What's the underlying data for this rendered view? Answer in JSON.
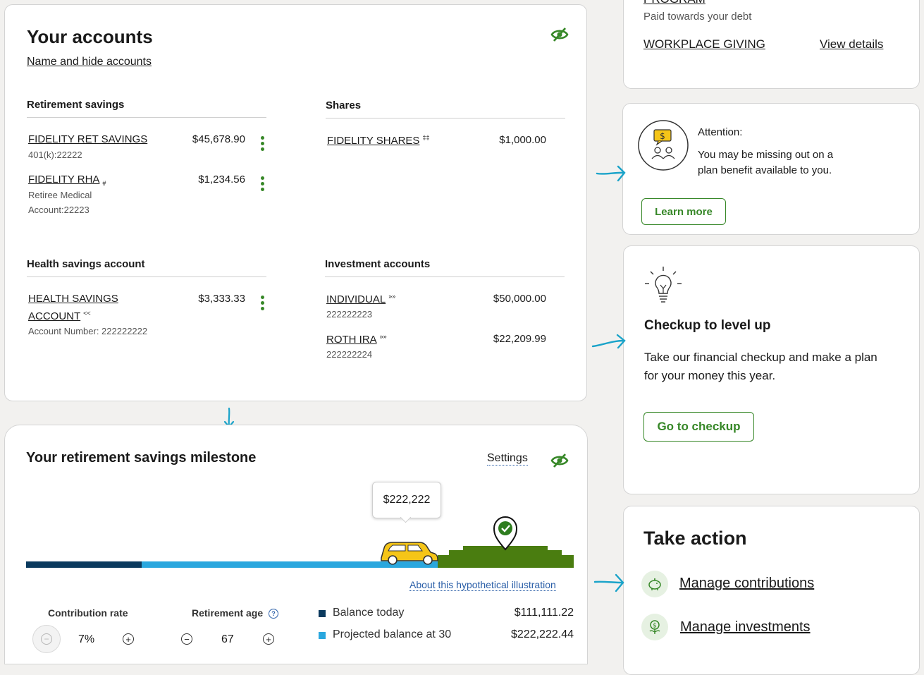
{
  "accounts": {
    "title": "Your accounts",
    "name_hide_link": "Name and hide accounts",
    "retirement": {
      "heading": "Retirement savings",
      "items": [
        {
          "name": "FIDELITY RET SAVINGS",
          "sub": "401(k):22222",
          "amount": "$45,678.90"
        },
        {
          "name": "FIDELITY RHA",
          "mark": "#",
          "sub1": "Retiree Medical",
          "sub2": "Account:22223",
          "amount": "$1,234.56"
        }
      ]
    },
    "shares": {
      "heading": "Shares",
      "items": [
        {
          "name": "FIDELITY SHARES",
          "mark": "‡‡",
          "amount": "$1,000.00"
        }
      ]
    },
    "hsa": {
      "heading": "Health savings account",
      "items": [
        {
          "name1": "HEALTH SAVINGS",
          "name2": "ACCOUNT",
          "mark": "<<",
          "sub": "Account Number: 222222222",
          "amount": "$3,333.33"
        }
      ]
    },
    "investment": {
      "heading": "Investment accounts",
      "items": [
        {
          "name": "INDIVIDUAL",
          "mark": "»»",
          "sub": "222222223",
          "amount": "$50,000.00"
        },
        {
          "name": "ROTH IRA",
          "mark": "»»",
          "sub": "222222224",
          "amount": "$22,209.99"
        }
      ]
    }
  },
  "milestone": {
    "title": "Your retirement savings milestone",
    "settings_link": "Settings",
    "tooltip_value": "$222,222",
    "about_link": "About this hypothetical illustration",
    "contribution_label": "Contribution rate",
    "contribution_value": "7%",
    "retirement_age_label": "Retirement age",
    "retirement_age_value": "67",
    "legend": [
      {
        "label": "Balance today",
        "value": "$111,111.22",
        "color": "#0b3a5e"
      },
      {
        "label": "Projected balance at 30",
        "value": "$222,222.44",
        "color": "#2aa7de"
      }
    ],
    "colors": {
      "today": "#0b3a5e",
      "projected": "#2aa7de",
      "goal": "#4a7d10",
      "car": "#f5c518"
    }
  },
  "debt_card": {
    "top_cut_text": "PROGRAM",
    "paid_text": "Paid towards your debt",
    "giving_link": "WORKPLACE GIVING",
    "details_link": "View details"
  },
  "attention_card": {
    "title": "Attention:",
    "line1": "You may be missing out on a",
    "line2": "plan benefit available to you.",
    "button": "Learn more"
  },
  "checkup_card": {
    "title": "Checkup to level up",
    "line1": "Take our financial checkup and make a plan",
    "line2": "for your money this year.",
    "button": "Go to checkup"
  },
  "action_card": {
    "title": "Take action",
    "links": [
      "Manage contributions",
      "Manage investments"
    ]
  },
  "accent_color": "#368727",
  "annotation_color": "#1aa3c9"
}
